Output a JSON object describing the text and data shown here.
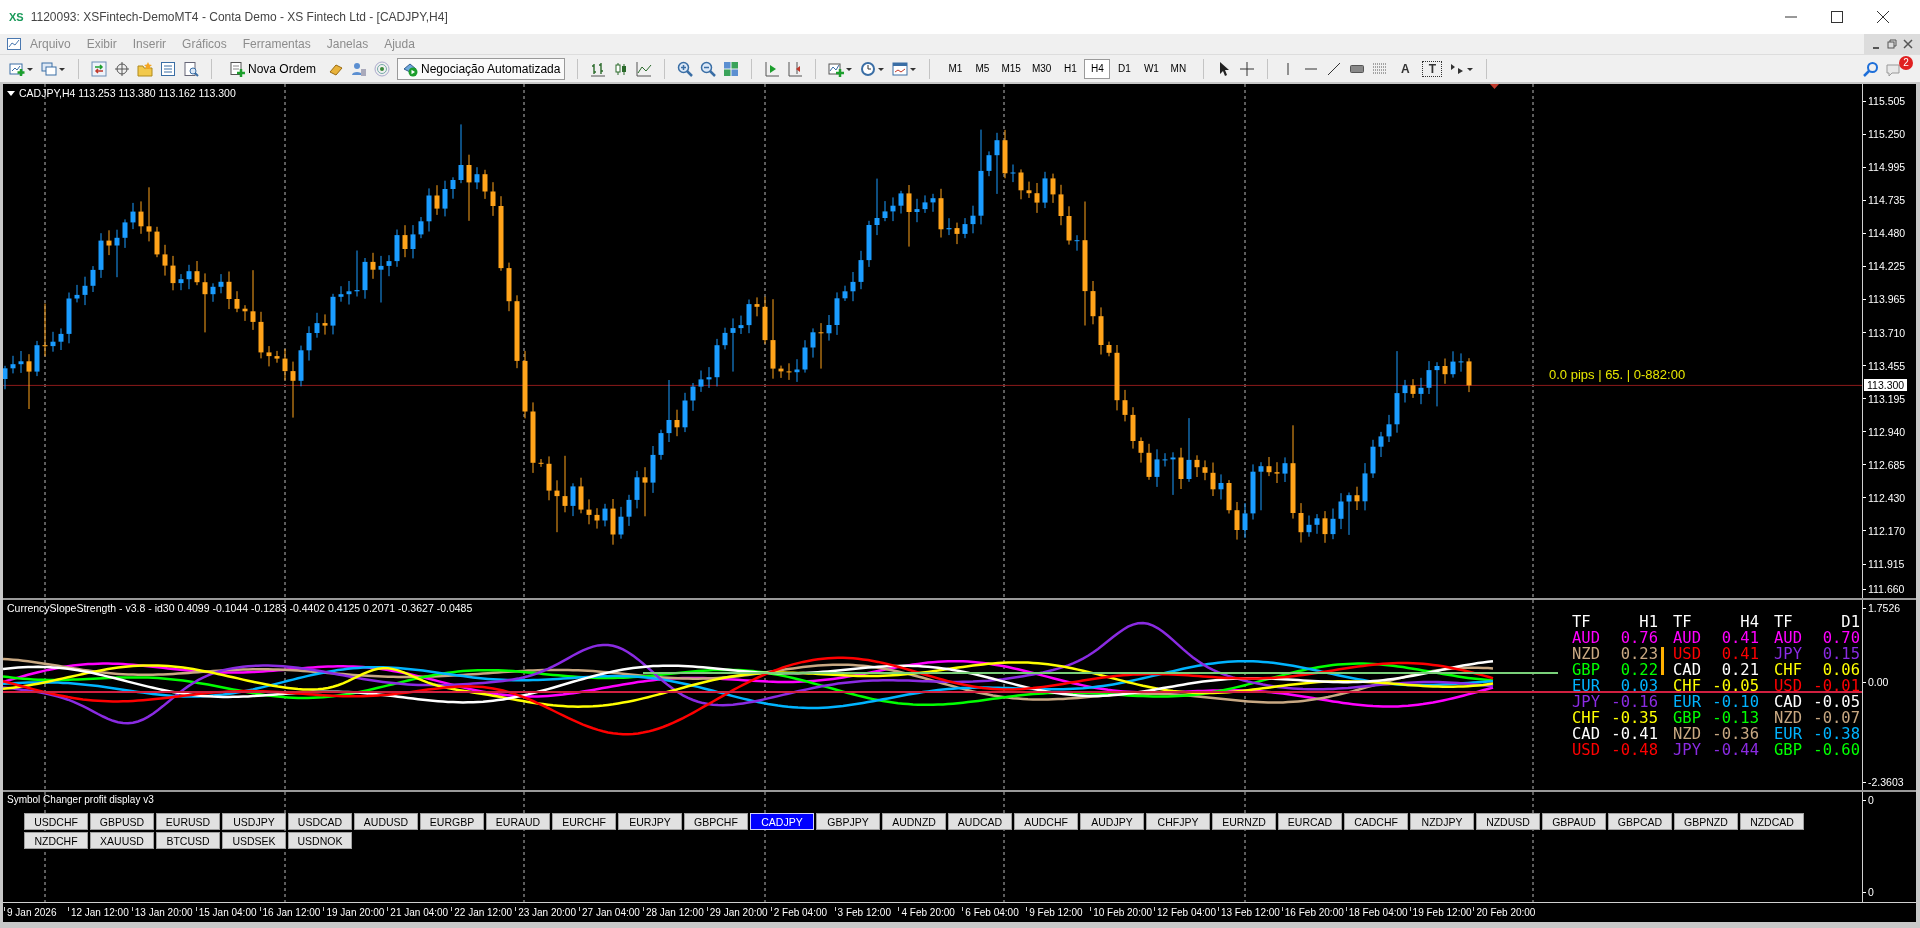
{
  "window": {
    "logo": "XS",
    "title": "1120093: XSFintech-DemoMT4 - Conta Demo - XS Fintech Ltd - [CADJPY,H4]"
  },
  "menu": [
    "Arquivo",
    "Exibir",
    "Inserir",
    "Gráficos",
    "Ferramentas",
    "Janelas",
    "Ajuda"
  ],
  "toolbar": {
    "new_order": "Nova Ordem",
    "auto_trading": {
      "label": "Negociação Automatizada",
      "on": true
    },
    "timeframes": [
      {
        "label": "M1",
        "selected": false
      },
      {
        "label": "M5",
        "selected": false
      },
      {
        "label": "M15",
        "selected": false
      },
      {
        "label": "M30",
        "selected": false
      },
      {
        "label": "H1",
        "selected": false
      },
      {
        "label": "H4",
        "selected": true
      },
      {
        "label": "D1",
        "selected": false
      },
      {
        "label": "W1",
        "selected": false
      },
      {
        "label": "MN",
        "selected": false
      }
    ],
    "text_tool": "A",
    "label_tool": "T",
    "notification_count": "2"
  },
  "chart": {
    "header": "CADJPY,H4  113.253 113.380 113.162 113.300",
    "price_info": "0.0 pips | 65. | 0-882:00",
    "price_axis": [
      "115.505",
      "115.250",
      "114.995",
      "114.735",
      "114.480",
      "114.225",
      "113.965",
      "113.710",
      "113.455",
      "113.195",
      "112.940",
      "112.685",
      "112.430",
      "112.170",
      "111.915",
      "111.660"
    ],
    "current_price": "113.300"
  },
  "indicator": {
    "header": "CurrencySlopeStrength - v3.8 - id30 0.4099 -0.1044 -0.1283 -0.4402 0.4125 0.2071 -0.3627 -0.0485",
    "axis": [
      "1.7526",
      "0.00",
      "-2.3603"
    ],
    "strength_table": [
      {
        "tf": "TF",
        "period": "H1",
        "rows": [
          {
            "currency": "AUD",
            "value": "0.76",
            "color": "#ff00ff"
          },
          {
            "currency": "NZD",
            "value": "0.23",
            "color": "#c8a882"
          },
          {
            "currency": "GBP",
            "value": "0.22",
            "color": "#00ff00"
          },
          {
            "currency": "EUR",
            "value": "0.03",
            "color": "#00b4ff"
          },
          {
            "currency": "JPY",
            "value": "-0.16",
            "color": "#8a2be2"
          },
          {
            "currency": "CHF",
            "value": "-0.35",
            "color": "#ffff00"
          },
          {
            "currency": "CAD",
            "value": "-0.41",
            "color": "#ffffff"
          },
          {
            "currency": "USD",
            "value": "-0.48",
            "color": "#ff0000"
          }
        ]
      },
      {
        "tf": "TF",
        "period": "H4",
        "rows": [
          {
            "currency": "AUD",
            "value": "0.41",
            "color": "#ff00ff"
          },
          {
            "currency": "USD",
            "value": "0.41",
            "color": "#ff0000"
          },
          {
            "currency": "CAD",
            "value": "0.21",
            "color": "#ffffff"
          },
          {
            "currency": "CHF",
            "value": "-0.05",
            "color": "#ffff00"
          },
          {
            "currency": "EUR",
            "value": "-0.10",
            "color": "#00b4ff"
          },
          {
            "currency": "GBP",
            "value": "-0.13",
            "color": "#00ff00"
          },
          {
            "currency": "NZD",
            "value": "-0.36",
            "color": "#c8a882"
          },
          {
            "currency": "JPY",
            "value": "-0.44",
            "color": "#8a2be2"
          }
        ]
      },
      {
        "tf": "TF",
        "period": "D1",
        "rows": [
          {
            "currency": "AUD",
            "value": "0.70",
            "color": "#ff00ff"
          },
          {
            "currency": "JPY",
            "value": "0.15",
            "color": "#8a2be2"
          },
          {
            "currency": "CHF",
            "value": "0.06",
            "color": "#ffff00"
          },
          {
            "currency": "USD",
            "value": "-0.01",
            "color": "#ff0000"
          },
          {
            "currency": "CAD",
            "value": "-0.05",
            "color": "#ffffff"
          },
          {
            "currency": "NZD",
            "value": "-0.07",
            "color": "#c8a882"
          },
          {
            "currency": "EUR",
            "value": "-0.38",
            "color": "#00b4ff"
          },
          {
            "currency": "GBP",
            "value": "-0.60",
            "color": "#00ff00"
          }
        ]
      }
    ]
  },
  "symbol_changer": {
    "title": "Symbol Changer profit display v3",
    "axis": [
      "0",
      "0"
    ],
    "symbols": [
      {
        "label": "USDCHF",
        "selected": false
      },
      {
        "label": "GBPUSD",
        "selected": false
      },
      {
        "label": "EURUSD",
        "selected": false
      },
      {
        "label": "USDJPY",
        "selected": false
      },
      {
        "label": "USDCAD",
        "selected": false
      },
      {
        "label": "AUDUSD",
        "selected": false
      },
      {
        "label": "EURGBP",
        "selected": false
      },
      {
        "label": "EURAUD",
        "selected": false
      },
      {
        "label": "EURCHF",
        "selected": false
      },
      {
        "label": "EURJPY",
        "selected": false
      },
      {
        "label": "GBPCHF",
        "selected": false
      },
      {
        "label": "CADJPY",
        "selected": true
      },
      {
        "label": "GBPJPY",
        "selected": false
      },
      {
        "label": "AUDNZD",
        "selected": false
      },
      {
        "label": "AUDCAD",
        "selected": false
      },
      {
        "label": "AUDCHF",
        "selected": false
      },
      {
        "label": "AUDJPY",
        "selected": false
      },
      {
        "label": "CHFJPY",
        "selected": false
      },
      {
        "label": "EURNZD",
        "selected": false
      },
      {
        "label": "EURCAD",
        "selected": false
      },
      {
        "label": "CADCHF",
        "selected": false
      },
      {
        "label": "NZDJPY",
        "selected": false
      },
      {
        "label": "NZDUSD",
        "selected": false
      },
      {
        "label": "GBPAUD",
        "selected": false
      },
      {
        "label": "GBPCAD",
        "selected": false
      },
      {
        "label": "GBPNZD",
        "selected": false
      },
      {
        "label": "NZDCAD",
        "selected": false
      },
      {
        "label": "NZDCHF",
        "selected": false
      },
      {
        "label": "XAUUSD",
        "selected": false
      },
      {
        "label": "BTCUSD",
        "selected": false
      },
      {
        "label": "USDSEK",
        "selected": false
      },
      {
        "label": "USDNOK",
        "selected": false
      }
    ]
  },
  "time_axis": [
    "9 Jan 2026",
    "12 Jan 12:00",
    "13 Jan 20:00",
    "15 Jan 04:00",
    "16 Jan 12:00",
    "19 Jan 20:00",
    "21 Jan 04:00",
    "22 Jan 12:00",
    "23 Jan 20:00",
    "27 Jan 04:00",
    "28 Jan 12:00",
    "29 Jan 20:00",
    "2 Feb 04:00",
    "3 Feb 12:00",
    "4 Feb 20:00",
    "6 Feb 04:00",
    "9 Feb 12:00",
    "10 Feb 20:00",
    "12 Feb 04:00",
    "13 Feb 12:00",
    "16 Feb 20:00",
    "18 Feb 04:00",
    "19 Feb 12:00",
    "20 Feb 20:00"
  ]
}
